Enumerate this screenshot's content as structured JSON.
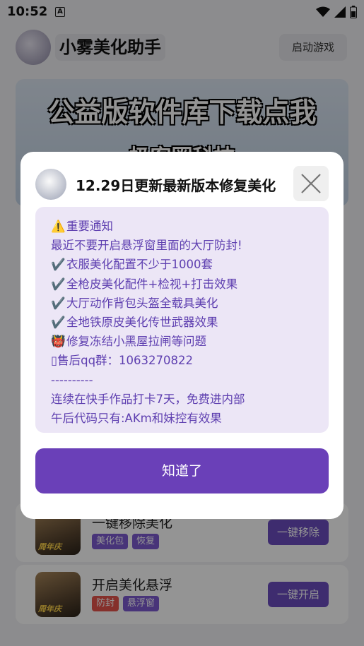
{
  "status_bar": {
    "time": "10:52",
    "notif_letter": "A"
  },
  "header": {
    "app_title": "小雾美化助手",
    "start_game_label": "启动游戏"
  },
  "banner": {
    "line1": "公益版软件库下载点我",
    "line2": "极客圈科技"
  },
  "cards": [
    {
      "title": "一键移除美化",
      "chips": [
        "美化包",
        "恢复"
      ],
      "action": "一键移除",
      "thumb_tag": "周年庆"
    },
    {
      "title": "开启美化悬浮",
      "chips": [
        "防封",
        "悬浮窗"
      ],
      "action": "一键开启",
      "thumb_tag": "周年庆"
    }
  ],
  "dialog": {
    "title": "12.29日更新最新版本修复美化",
    "lines": [
      {
        "icon": "⚠️",
        "text": "重要通知"
      },
      {
        "icon": "",
        "text": "最近不要开启悬浮窗里面的大厅防封!"
      },
      {
        "icon": "✔️",
        "text": "衣服美化配置不少于1000套"
      },
      {
        "icon": "✔️",
        "text": "全枪皮美化配件+检视+打击效果"
      },
      {
        "icon": "✔️",
        "text": "大厅动作背包头盔全载具美化"
      },
      {
        "icon": "✔️",
        "text": "全地铁原皮美化传世武器效果"
      },
      {
        "icon": "👹",
        "text": "修复冻结小黑屋拉闸等问题"
      },
      {
        "icon": "▯",
        "text": "售后qq群：1063270822"
      },
      {
        "icon": "",
        "text": "----------"
      },
      {
        "icon": "",
        "text": "连续在快手作品打卡7天，免费进内部"
      },
      {
        "icon": "",
        "text": "午后代码只有:AKm和妹控有效果"
      }
    ],
    "confirm_label": "知道了"
  },
  "colors": {
    "accent": "#6a40b8",
    "notice_bg": "#ece6f6",
    "notice_text": "#5e3fb0"
  }
}
